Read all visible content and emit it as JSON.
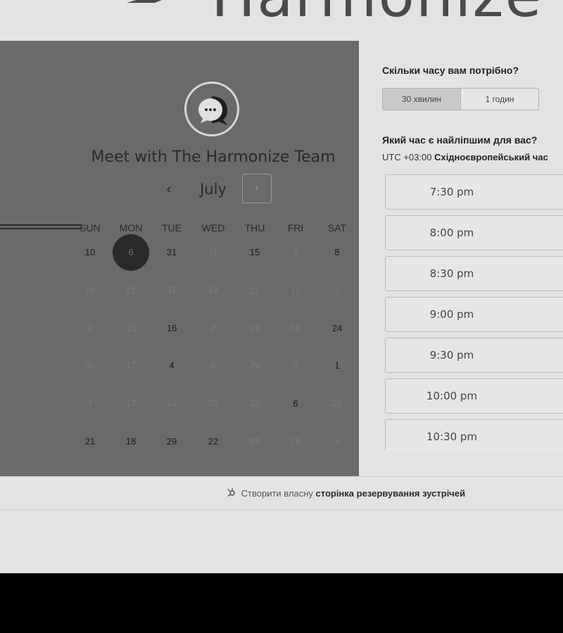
{
  "brand": {
    "logo_text": "Harmonize",
    "logo_icon": "harmonize-logo-icon"
  },
  "calendar": {
    "avatar_icon": "chat-bubble-icon",
    "title": "Meet with The Harmonize Team",
    "month": "July",
    "prev_label": "‹",
    "next_label": "›",
    "weekdays": [
      "SUN",
      "MON",
      "TUE",
      "WED",
      "THU",
      "FRI",
      "SAT"
    ],
    "rows": [
      [
        {
          "t": "10",
          "s": "on"
        },
        {
          "t": "6",
          "s": "sel"
        },
        {
          "t": "31",
          "s": "on"
        },
        {
          "t": "11",
          "s": "off"
        },
        {
          "t": "15",
          "s": "on"
        },
        {
          "t": "2",
          "s": "off"
        },
        {
          "t": "8",
          "s": "on"
        }
      ],
      [
        {
          "t": "19",
          "s": "off"
        },
        {
          "t": "21",
          "s": "off"
        },
        {
          "t": "31",
          "s": "off"
        },
        {
          "t": "18",
          "s": "off"
        },
        {
          "t": "11",
          "s": "off"
        },
        {
          "t": "11",
          "s": "off"
        },
        {
          "t": "2",
          "s": "off"
        }
      ],
      [
        {
          "t": "2",
          "s": "off"
        },
        {
          "t": "13",
          "s": "off"
        },
        {
          "t": "16",
          "s": "on"
        },
        {
          "t": "2",
          "s": "off"
        },
        {
          "t": "28",
          "s": "off"
        },
        {
          "t": "18",
          "s": "off"
        },
        {
          "t": "24",
          "s": "on"
        }
      ],
      [
        {
          "t": "30",
          "s": "off"
        },
        {
          "t": "17",
          "s": "off"
        },
        {
          "t": "4",
          "s": "on"
        },
        {
          "t": "6",
          "s": "off"
        },
        {
          "t": "29",
          "s": "off"
        },
        {
          "t": "6",
          "s": "off"
        },
        {
          "t": "1",
          "s": "on"
        }
      ],
      [
        {
          "t": "7",
          "s": "off"
        },
        {
          "t": "17",
          "s": "off"
        },
        {
          "t": "14",
          "s": "off"
        },
        {
          "t": "28",
          "s": "off"
        },
        {
          "t": "28",
          "s": "off"
        },
        {
          "t": "6",
          "s": "on"
        },
        {
          "t": "22",
          "s": "off"
        }
      ],
      [
        {
          "t": "21",
          "s": "on"
        },
        {
          "t": "18",
          "s": "on"
        },
        {
          "t": "29",
          "s": "on"
        },
        {
          "t": "22",
          "s": "on"
        },
        {
          "t": "29",
          "s": "off"
        },
        {
          "t": "28",
          "s": "off"
        },
        {
          "t": "5",
          "s": "off"
        }
      ]
    ]
  },
  "duration": {
    "question": "Скільки часу вам потрібно?",
    "options": [
      "30 хвилин",
      "1 годин"
    ],
    "selected": "30 хвилин"
  },
  "time": {
    "question": "Який час є найліпшим для вас?",
    "timezone_offset": "UTC +03:00",
    "timezone_name": "Східноєвропейський час",
    "slots": [
      "7:30 pm",
      "8:00 pm",
      "8:30 pm",
      "9:00 pm",
      "9:30 pm",
      "10:00 pm",
      "10:30 pm"
    ]
  },
  "footer": {
    "icon": "hubspot-sprocket-icon",
    "prefix": "Створити власну",
    "link_text": "сторінка резервування зустрічей"
  }
}
